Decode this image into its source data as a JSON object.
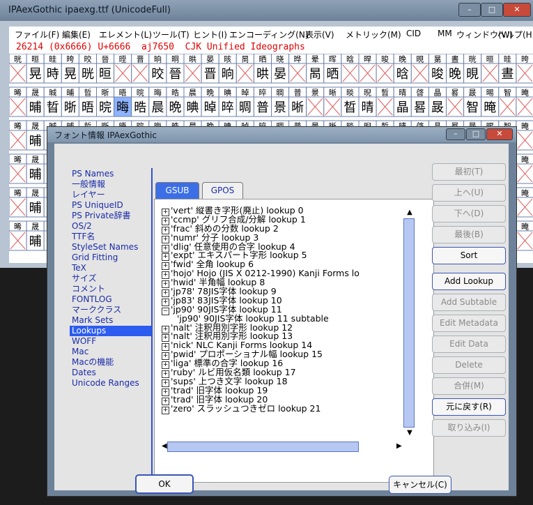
{
  "main_window": {
    "title": "IPAexGothic  ipaexg.ttf (UnicodeFull)",
    "controls": [
      "–",
      "□",
      "✕"
    ],
    "menu": [
      "ファイル(F)",
      "編集(E)",
      "エレメント(L)",
      "ツール(T)",
      "ヒント(I)",
      "エンコーディング(N)",
      "表示(V)",
      "メトリック(M)",
      "CID",
      "MM",
      "ウィンドウ(W)",
      "ヘルプ(H)"
    ],
    "status": "26214 (0x6666) U+6666  aj7650  CJK Unified Ideographs"
  },
  "glyph_grid": {
    "rows": [
      {
        "labels": [
          "晄",
          "晅",
          "晆",
          "晇",
          "晈",
          "晉",
          "晊",
          "晋",
          "晌",
          "晍",
          "晎",
          "晏",
          "晐",
          "晑",
          "晒",
          "晓",
          "晔",
          "晕",
          "晖",
          "晗",
          "晘",
          "晙",
          "晚",
          "晛",
          "晜",
          "晝"
        ],
        "glyphs": [
          "",
          "晃",
          "時",
          "晃",
          "晄",
          "晅",
          "",
          "",
          "晈",
          "晉",
          "",
          "晋",
          "晌",
          "",
          "晎",
          "晏",
          "",
          "晑",
          "晒",
          "",
          "",
          "",
          "晗",
          "",
          "晙",
          "晚",
          "晛",
          "",
          "晝"
        ]
      },
      {
        "labels": [
          "晞",
          "晟",
          "晠",
          "晡",
          "晢",
          "晣",
          "晤",
          "晥",
          "晦",
          "晧",
          "晨",
          "晩",
          "晪",
          "晫",
          "晬",
          "晭",
          "普",
          "景",
          "晰",
          "晱",
          "晲",
          "晳",
          "晴",
          "晵",
          "晶",
          "晷",
          "晸",
          "晹",
          "智",
          "晻",
          "晼",
          "晽"
        ],
        "glyphs": [
          "",
          "晡",
          "晢",
          "晣",
          "晤",
          "晥",
          "晦",
          "晧",
          "晨",
          "晩",
          "晪",
          "晫",
          "晬",
          "晭",
          "普",
          "景",
          "晰",
          "",
          "",
          "晳",
          "晴",
          "",
          "晶",
          "晷",
          "晸",
          "",
          "智",
          "晻",
          ""
        ]
      }
    ],
    "selected": "晦"
  },
  "dialog": {
    "title": "フォント情報 IPAexGothic",
    "sidebar": [
      {
        "label": "PS Names",
        "selected": false
      },
      {
        "label": "一般情報",
        "selected": false
      },
      {
        "label": "レイヤー",
        "selected": false
      },
      {
        "label": "PS UniqueID",
        "selected": false
      },
      {
        "label": "PS Private辞書",
        "selected": false
      },
      {
        "label": "OS/2",
        "selected": false
      },
      {
        "label": "TTF名",
        "selected": false
      },
      {
        "label": "StyleSet Names",
        "selected": false
      },
      {
        "label": "Grid Fitting",
        "selected": false
      },
      {
        "label": "TeX",
        "selected": false
      },
      {
        "label": "サイズ",
        "selected": false
      },
      {
        "label": "コメント",
        "selected": false
      },
      {
        "label": "FONTLOG",
        "selected": false
      },
      {
        "label": "マーククラス",
        "selected": false
      },
      {
        "label": "Mark Sets",
        "selected": false
      },
      {
        "label": "Lookups",
        "selected": true
      },
      {
        "label": "WOFF",
        "selected": false
      },
      {
        "label": "Mac",
        "selected": false
      },
      {
        "label": "Macの機能",
        "selected": false
      },
      {
        "label": "Dates",
        "selected": false
      },
      {
        "label": "Unicode Ranges",
        "selected": false
      }
    ],
    "tabs": [
      "GSUB",
      "GPOS"
    ],
    "lookups": [
      {
        "text": "'vert' 縦書き字形(廃止) lookup 0",
        "sub": false
      },
      {
        "text": "'ccmp' グリフ合成/分解 lookup 1",
        "sub": false
      },
      {
        "text": "'frac' 斜めの分数 lookup 2",
        "sub": false
      },
      {
        "text": "'numr' 分子 lookup 3",
        "sub": false
      },
      {
        "text": "'dlig' 任意使用の合字 lookup 4",
        "sub": false
      },
      {
        "text": "'expt' エキスパート字形 lookup 5",
        "sub": false
      },
      {
        "text": "'fwid' 全角 lookup 6",
        "sub": false
      },
      {
        "text": "'hojo' Hojo (JIS X 0212-1990) Kanji Forms lo",
        "sub": false
      },
      {
        "text": "'hwid' 半角幅 lookup 8",
        "sub": false
      },
      {
        "text": "'jp78' 78JIS字体 lookup 9",
        "sub": false
      },
      {
        "text": "'jp83' 83JIS字体 lookup 10",
        "sub": false
      },
      {
        "text": "'jp90' 90JIS字体 lookup 11",
        "sub": false,
        "expanded": true
      },
      {
        "text": "'jp90' 90JIS字体 lookup 11 subtable",
        "sub": true
      },
      {
        "text": "'nalt' 注釈用別字形 lookup 12",
        "sub": false
      },
      {
        "text": "'nalt' 注釈用別字形 lookup 13",
        "sub": false
      },
      {
        "text": "'nick' NLC Kanji Forms lookup 14",
        "sub": false
      },
      {
        "text": "'pwid' プロポーショナル幅 lookup 15",
        "sub": false
      },
      {
        "text": "'liga' 標準の合字 lookup 16",
        "sub": false
      },
      {
        "text": "'ruby' ルビ用仮名類 lookup 17",
        "sub": false
      },
      {
        "text": "'sups' 上つき文字 lookup 18",
        "sub": false
      },
      {
        "text": "'trad' 旧字体 lookup 19",
        "sub": false
      },
      {
        "text": "'trad' 旧字体 lookup 20",
        "sub": false
      },
      {
        "text": "'zero' スラッシュつきゼロ lookup 21",
        "sub": false
      }
    ],
    "buttons": [
      {
        "label": "最初(T)",
        "enabled": false
      },
      {
        "label": "上へ(U)",
        "enabled": false
      },
      {
        "label": "下へ(D)",
        "enabled": false
      },
      {
        "label": "最後(B)",
        "enabled": false
      },
      {
        "label": "Sort",
        "enabled": true
      },
      {
        "label": "Add Lookup",
        "enabled": true
      },
      {
        "label": "Add Subtable",
        "enabled": false
      },
      {
        "label": "Edit Metadata",
        "enabled": false
      },
      {
        "label": "Edit Data",
        "enabled": false
      },
      {
        "label": "Delete",
        "enabled": false
      },
      {
        "label": "合併(M)",
        "enabled": false
      },
      {
        "label": "元に戻す(R)",
        "enabled": true
      },
      {
        "label": "取り込み(I)",
        "enabled": false
      }
    ],
    "ok_label": "OK",
    "cancel_label": "キャンセル(C)"
  }
}
